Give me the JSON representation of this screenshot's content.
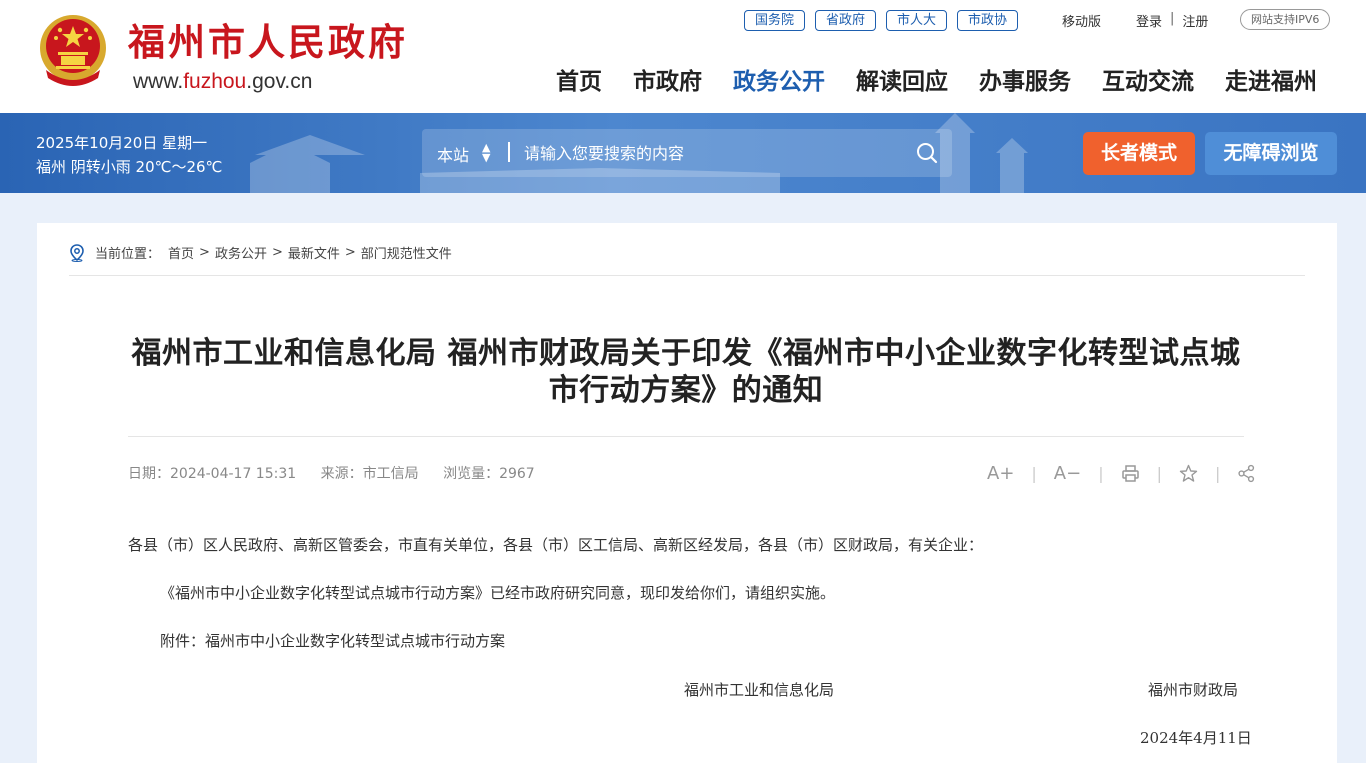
{
  "header": {
    "site_name": "福州市人民政府",
    "site_url_prefix": "www.",
    "site_url_accent": "fuzhou",
    "site_url_suffix": ".gov.cn",
    "top_links": [
      "国务院",
      "省政府",
      "市人大",
      "市政协"
    ],
    "mobile_label": "移动版",
    "login_label": "登录",
    "login_sep": "|",
    "register_label": "注册",
    "ipv6_label": "网站支持IPV6",
    "nav": [
      "首页",
      "市政府",
      "政务公开",
      "解读回应",
      "办事服务",
      "互动交流",
      "走进福州"
    ],
    "active_nav": "政务公开"
  },
  "banner": {
    "date_text": "2025年10月20日 星期一",
    "weather_text": "福州 阴转小雨 20℃～26℃",
    "search_scope": "本站",
    "search_placeholder": "请输入您要搜索的内容",
    "elder_mode_label": "长者模式",
    "accessible_label": "无障碍浏览"
  },
  "breadcrumb": {
    "prefix": "当前位置：",
    "items": [
      "首页",
      "政务公开",
      "最新文件",
      "部门规范性文件"
    ],
    "separator": ">"
  },
  "article": {
    "title": "福州市工业和信息化局 福州市财政局关于印发《福州市中小企业数字化转型试点城市行动方案》的通知",
    "date": "日期：2024-04-17 15:31",
    "source": "来源：市工信局",
    "views": "浏览量：2967",
    "font_increase_label": "A+",
    "font_decrease_label": "A−",
    "tool_sep": "|",
    "para1": "各县（市）区人民政府、高新区管委会，市直有关单位，各县（市）区工信局、高新区经发局，各县（市）区财政局，有关企业：",
    "para2": "《福州市中小企业数字化转型试点城市行动方案》已经市政府研究同意，现印发给你们，请组织实施。",
    "para3": "附件：福州市中小企业数字化转型试点城市行动方案",
    "signer1": "福州市工业和信息化局",
    "signer2": "福州市财政局",
    "sign_date": "2024年4月11日"
  },
  "colors": {
    "brand_red": "#c8161d",
    "accent_blue": "#1d5eaf",
    "banner_blue": "#3a74c2",
    "elder_orange": "#f0612d"
  }
}
